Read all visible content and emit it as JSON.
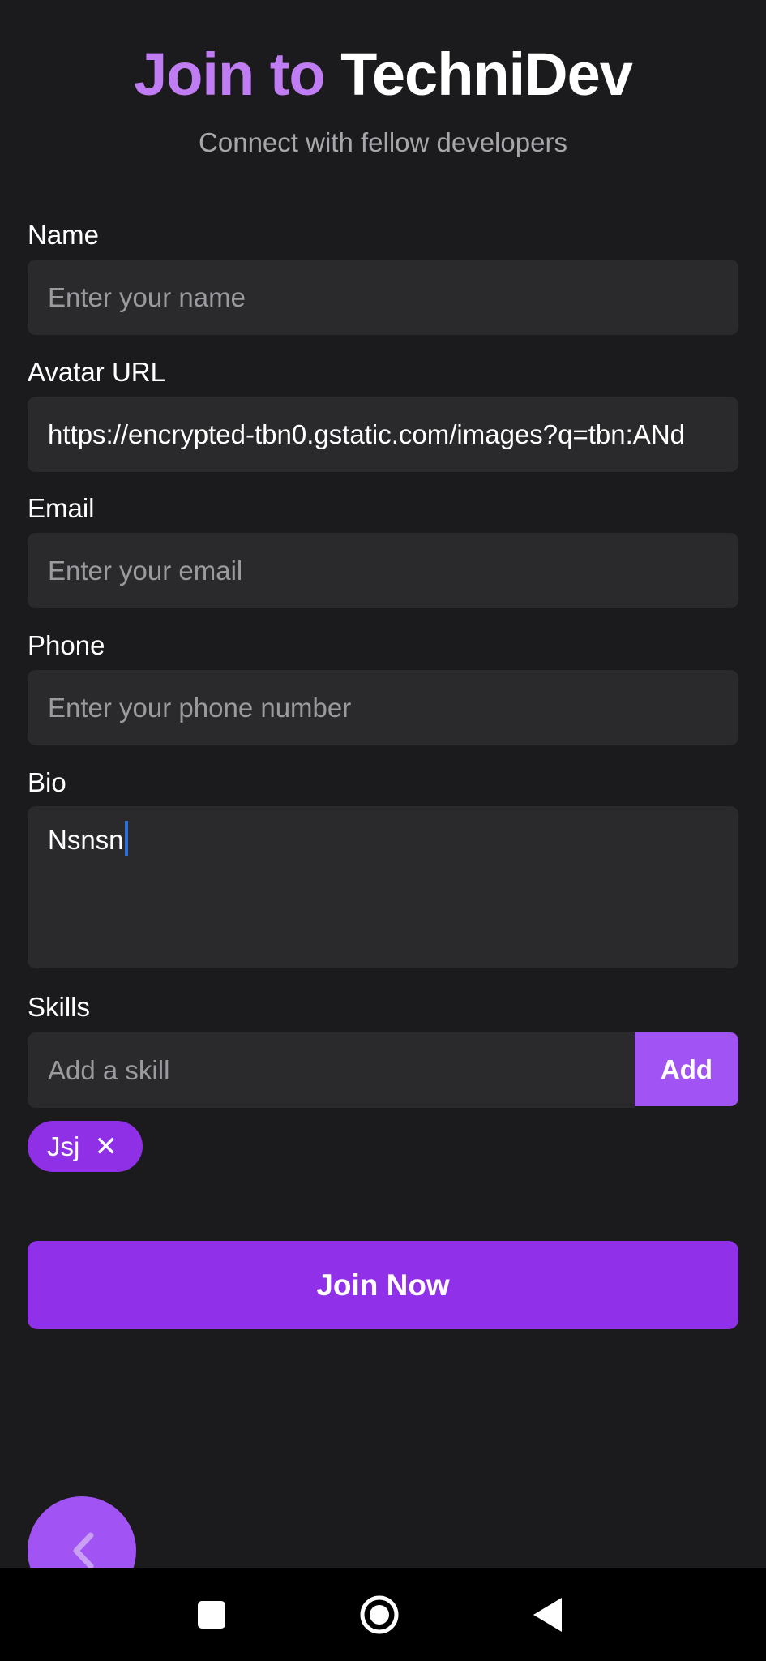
{
  "header": {
    "title_part1": "Join to",
    "title_part2": "TechniDev",
    "subtitle": "Connect with fellow developers"
  },
  "form": {
    "name": {
      "label": "Name",
      "placeholder": "Enter your name",
      "value": ""
    },
    "avatar": {
      "label": "Avatar URL",
      "value": "https://encrypted-tbn0.gstatic.com/images?q=tbn:ANd"
    },
    "email": {
      "label": "Email",
      "placeholder": "Enter your email",
      "value": ""
    },
    "phone": {
      "label": "Phone",
      "placeholder": "Enter your phone number",
      "value": ""
    },
    "bio": {
      "label": "Bio",
      "value": "Nsnsn"
    },
    "skills": {
      "label": "Skills",
      "placeholder": "Add a skill",
      "add_label": "Add",
      "items": [
        {
          "label": "Jsj",
          "remove_icon": "close-icon"
        }
      ]
    }
  },
  "actions": {
    "submit_label": "Join Now",
    "back_icon": "chevron-left-icon"
  },
  "system_nav": {
    "items": [
      "recents-square-icon",
      "home-circle-icon",
      "back-triangle-icon"
    ]
  },
  "colors": {
    "background": "#1b1b1d",
    "field": "#2a2a2c",
    "accent": "#c07cf2",
    "primary": "#9030e8",
    "button_light": "#a153f3"
  }
}
